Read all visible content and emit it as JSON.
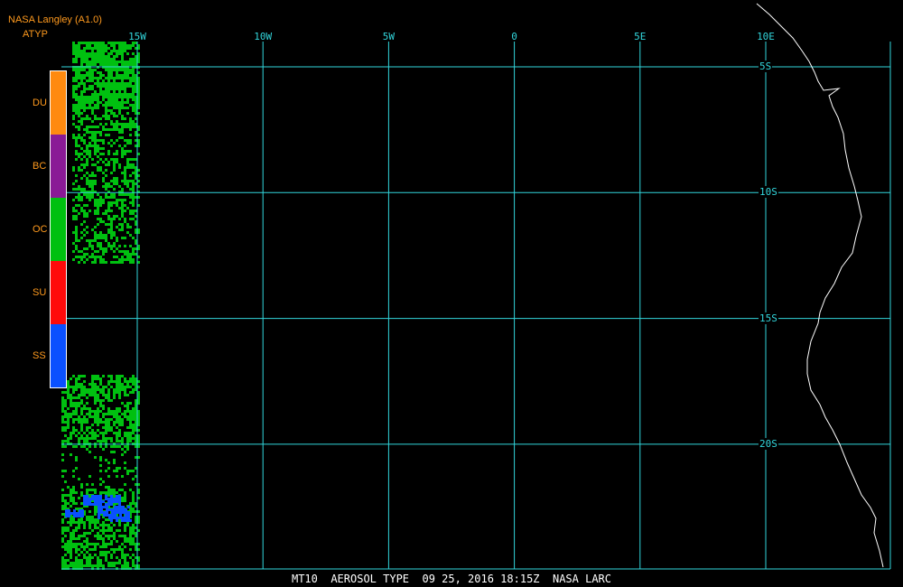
{
  "header": {
    "title": "NASA Langley (A1.0)",
    "product": "ATYP"
  },
  "legend": [
    {
      "code": "DU",
      "color": "#ff8a10"
    },
    {
      "code": "BC",
      "color": "#8a1a96"
    },
    {
      "code": "OC",
      "color": "#00c010"
    },
    {
      "code": "SU",
      "color": "#ff0a0a"
    },
    {
      "code": "SS",
      "color": "#0a50ff"
    }
  ],
  "map": {
    "grid_color": "#32d6dc",
    "coast_color": "#ffffff",
    "longitudes": [
      {
        "label": "15W",
        "lon": -15
      },
      {
        "label": "10W",
        "lon": -10
      },
      {
        "label": "5W",
        "lon": -5
      },
      {
        "label": "0",
        "lon": 0
      },
      {
        "label": "5E",
        "lon": 5
      },
      {
        "label": "10E",
        "lon": 10
      }
    ],
    "latitudes": [
      {
        "label": "5S",
        "lat": -5
      },
      {
        "label": "10S",
        "lat": -10
      },
      {
        "label": "15S",
        "lat": -15
      },
      {
        "label": "20S",
        "lat": -20
      }
    ]
  },
  "footer": "MT10  AEROSOL TYPE  09 25, 2016 18:15Z  NASA LARC"
}
